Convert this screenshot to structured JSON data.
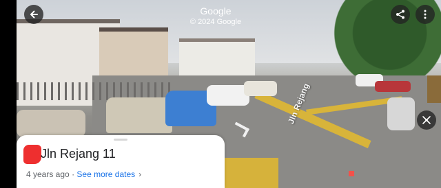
{
  "watermark": {
    "logo": "Google",
    "copyright": "© 2024 Google"
  },
  "street_view": {
    "road_label": "Jln Rejang"
  },
  "card": {
    "title": "Jln Rejang 11",
    "age": "4 years ago",
    "separator": "·",
    "see_more_label": "See more dates",
    "chevron": "›"
  },
  "icons": {
    "back": "arrow-left-icon",
    "share": "share-icon",
    "more": "more-vertical-icon",
    "compass": "compass-icon",
    "redaction": "redaction-mark"
  },
  "colors": {
    "accent": "#1a73e8",
    "card_bg": "#ffffff",
    "redaction": "#ee2f2f"
  }
}
